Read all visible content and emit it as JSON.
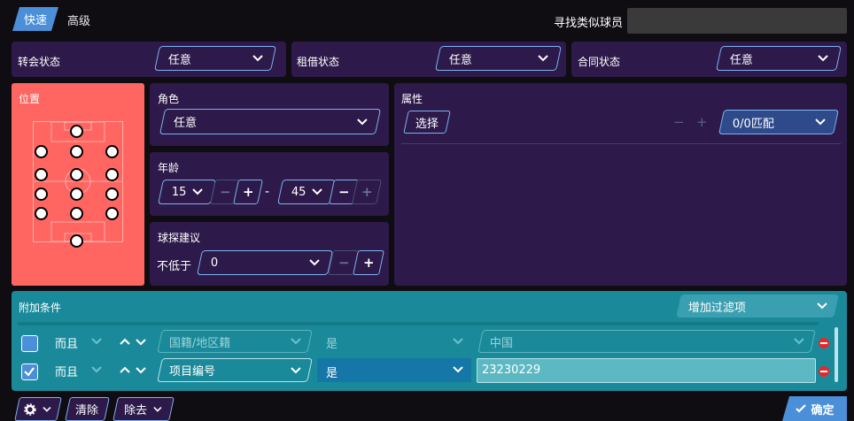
{
  "tabs": {
    "quick": "快速",
    "advanced": "高级"
  },
  "find_similar": {
    "label": "寻找类似球员",
    "value": ""
  },
  "filters_row": [
    {
      "label": "转会状态",
      "value": "任意"
    },
    {
      "label": "租借状态",
      "value": "任意"
    },
    {
      "label": "合同状态",
      "value": "任意"
    }
  ],
  "position": {
    "title": "位置"
  },
  "role": {
    "title": "角色",
    "value": "任意"
  },
  "age": {
    "title": "年龄",
    "min": "15",
    "sep": "-",
    "max": "45",
    "minus": "−",
    "plus": "+"
  },
  "scout": {
    "title": "球探建议",
    "prefix": "不低于",
    "value": "0",
    "minus": "−",
    "plus": "+"
  },
  "attributes": {
    "title": "属性",
    "select_label": "选择",
    "minus": "−",
    "plus": "+",
    "match": "0/0匹配"
  },
  "extra": {
    "title": "附加条件",
    "add_filter": "增加过滤项",
    "rows": [
      {
        "conj": "而且",
        "field": "国籍/地区籍",
        "op": "是",
        "value": "中国",
        "checked": false
      },
      {
        "conj": "而且",
        "field": "项目编号",
        "op": "是",
        "value": "23230229",
        "checked": true
      }
    ]
  },
  "bottom": {
    "clear": "清除",
    "remove": "除去",
    "confirm": "确定"
  },
  "colors": {
    "accent": "#4a8fd8",
    "panel": "#2d1a4a",
    "position": "#ff6661",
    "extra": "#1a8a9a",
    "remove": "#e8272b"
  }
}
